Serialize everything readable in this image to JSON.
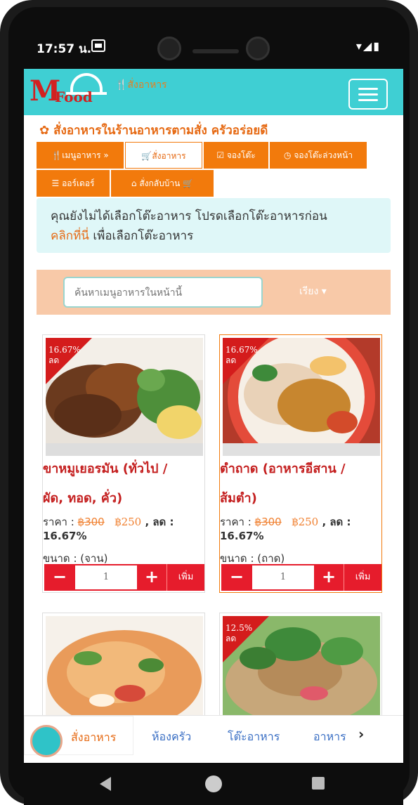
{
  "status_bar": {
    "time": "17:57 น."
  },
  "navbar": {
    "logo_m": "M",
    "logo_food": "Food",
    "brand_label": "สั่งอาหาร"
  },
  "page_title": "สั่งอาหารในร้านอาหารตามสั่ง ครัวอร่อยดี",
  "tabs": [
    {
      "label": "เมนูอาหาร »"
    },
    {
      "label": "สั่งอาหาร"
    },
    {
      "label": "จองโต๊ะ"
    },
    {
      "label": "จองโต๊ะล่วงหน้า"
    },
    {
      "label": "ออร์เดอร์"
    },
    {
      "label": "สั่งกลับบ้าน"
    }
  ],
  "alert": {
    "text1": "คุณยังไม่ได้เลือกโต๊ะอาหาร โปรดเลือกโต๊ะอาหารก่อน",
    "link": "คลิกที่นี่",
    "text2": " เพื่อเลือกโต๊ะอาหาร"
  },
  "search": {
    "placeholder": "ค้นหาเมนูอาหารในหน้านี้",
    "sort_label": "เรียง ▾"
  },
  "products": [
    {
      "discount": "16.67%",
      "discount_unit": "ลด",
      "name1": "ขาหมูเยอรมัน (ทั่วไป /",
      "name2": "ผัด, ทอด, คั่ว)",
      "price_label": "ราคา : ",
      "old_price": "฿300",
      "new_price": "฿250",
      "disc_text": " , ลด :",
      "disc_value": "16.67%",
      "size": "ขนาด : (จาน)",
      "qty": "1",
      "add": "เพิ่ม"
    },
    {
      "discount": "16.67%",
      "discount_unit": "ลด",
      "name1": "ตำถาด (อาหารอีสาน /",
      "name2": "ส้มตำ)",
      "price_label": "ราคา : ",
      "old_price": "฿300",
      "new_price": "฿250",
      "disc_text": " , ลด :",
      "disc_value": "16.67%",
      "size": "ขนาด : (ถาด)",
      "qty": "1",
      "add": "เพิ่ม"
    },
    {
      "discount": "",
      "discount_unit": ""
    },
    {
      "discount": "12.5%",
      "discount_unit": "ลด"
    }
  ],
  "bottom_nav": [
    {
      "label": "สั่งอาหาร"
    },
    {
      "label": "ห้องครัว"
    },
    {
      "label": "โต๊ะอาหาร"
    },
    {
      "label": "อาหาร"
    }
  ],
  "colors": {
    "navbar": "#3fcfd3",
    "accent": "#f27a0c",
    "danger": "#e61c2c",
    "title": "#e66a14"
  }
}
